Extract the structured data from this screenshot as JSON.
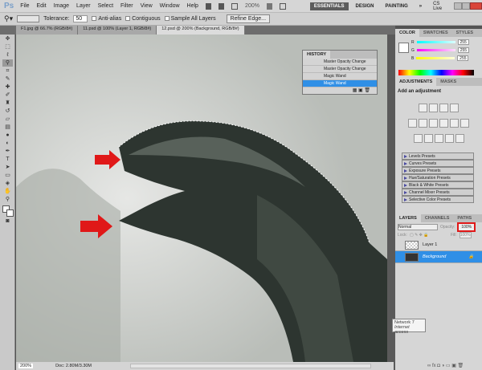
{
  "app": {
    "logo": "Ps"
  },
  "menu": [
    "File",
    "Edit",
    "Image",
    "Layer",
    "Select",
    "Filter",
    "View",
    "Window",
    "Help"
  ],
  "zoom_menu": "200%",
  "workspaces": [
    "ESSENTIALS",
    "DESIGN",
    "PAINTING"
  ],
  "workspace_more": "»",
  "cs_live": "CS Live",
  "options": {
    "tolerance_label": "Tolerance:",
    "tolerance": "50",
    "anti_alias": "Anti-alias",
    "contiguous": "Contiguous",
    "sample_all": "Sample All Layers",
    "refine_edge": "Refine Edge..."
  },
  "doc_tabs": [
    "F1.jpg @ 66.7% (RGB/8#)",
    "11.psd @ 100% (Layer 1, RGB/8#)",
    "12.psd @ 200% (Background, RGB/8#)"
  ],
  "history": {
    "title": "HISTORY",
    "items": [
      "Master Opacity Change",
      "Master Opacity Change",
      "Magic Wand",
      "Magic Wand"
    ]
  },
  "color": {
    "tabs": [
      "COLOR",
      "SWATCHES",
      "STYLES"
    ],
    "channels": [
      {
        "label": "R",
        "value": "255"
      },
      {
        "label": "G",
        "value": "255"
      },
      {
        "label": "B",
        "value": "255"
      }
    ]
  },
  "adjustments": {
    "tabs": [
      "ADJUSTMENTS",
      "MASKS"
    ],
    "title": "Add an adjustment",
    "presets": [
      "Levels Presets",
      "Curves Presets",
      "Exposure Presets",
      "Hue/Saturation Presets",
      "Black & White Presets",
      "Channel Mixer Presets",
      "Selective Color Presets"
    ]
  },
  "layers": {
    "tabs": [
      "LAYERS",
      "CHANNELS",
      "PATHS"
    ],
    "blend": "Normal",
    "opacity_label": "Opacity:",
    "opacity": "100%",
    "lock_label": "Lock:",
    "fill_label": "Fill:",
    "fill": "100%",
    "items": [
      "Layer 1",
      "Background"
    ]
  },
  "status": {
    "zoom": "200%",
    "doc": "Doc: 2.80M/3.30M"
  },
  "tooltip": {
    "line1": "Network 7",
    "line2": "Internet access"
  },
  "colors": {
    "accent": "#2f8fe6",
    "highlight": "#e01818"
  }
}
